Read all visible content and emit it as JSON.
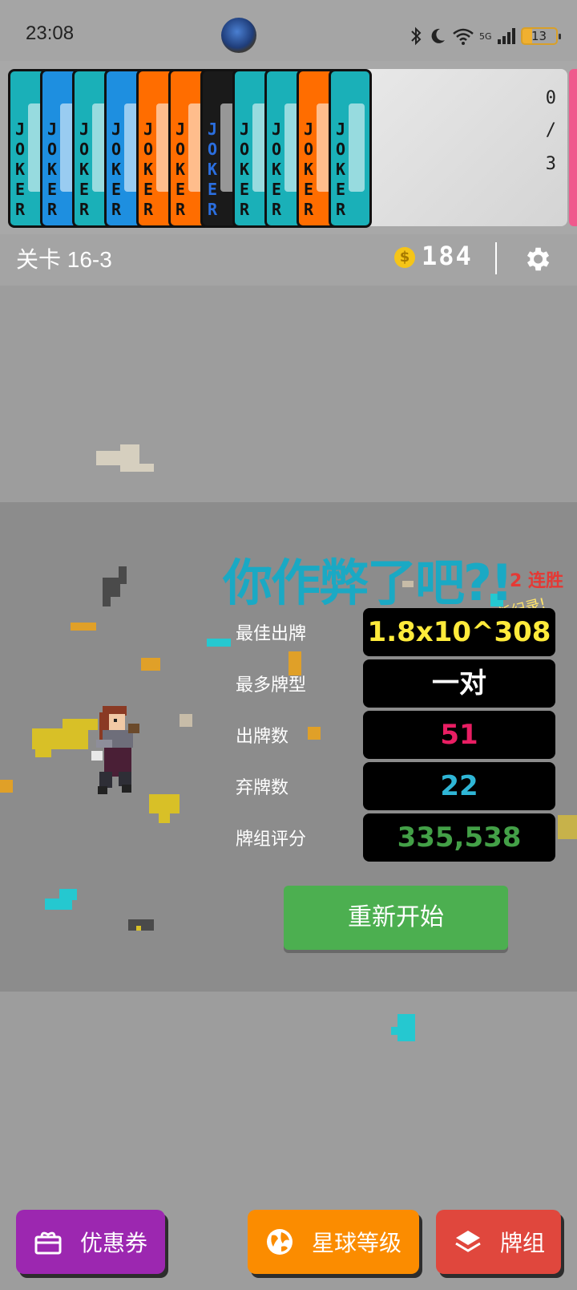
{
  "status_bar": {
    "time": "23:08",
    "network": "5G",
    "battery": "13"
  },
  "card_strip": {
    "card_word": "JOKER",
    "counter": {
      "current": "0",
      "separator": "/",
      "total": "3"
    },
    "card_colors": [
      "#1ab0b8",
      "#1e8fe0",
      "#1ab0b8",
      "#1e8fe0",
      "#ff6d00",
      "#ff6d00",
      "#1a1a1a",
      "#1ab0b8",
      "#1ab0b8",
      "#ff6d00",
      "#1ab0b8"
    ]
  },
  "info_bar": {
    "level": "关卡 16-3",
    "coins": "184"
  },
  "result": {
    "title": "你作弊了吧?!",
    "streak": "2 连胜",
    "new_record": "新纪录!",
    "stats": [
      {
        "label": "最佳出牌",
        "value": "1.8x10^308",
        "color": "#ffeb3b"
      },
      {
        "label": "最多牌型",
        "value": "一对",
        "color": "#ffffff"
      },
      {
        "label": "出牌数",
        "value": "51",
        "color": "#e91e63"
      },
      {
        "label": "弃牌数",
        "value": "22",
        "color": "#2fb6d6"
      },
      {
        "label": "牌组评分",
        "value": "335,538",
        "color": "#43a047"
      }
    ],
    "restart_label": "重新开始"
  },
  "bottom_nav": {
    "coupon_label": "优惠券",
    "coupon_color": "#9c27b0",
    "planet_label": "星球等级",
    "planet_color": "#fb8c00",
    "deck_label": "牌组",
    "deck_color": "#e0473d"
  }
}
